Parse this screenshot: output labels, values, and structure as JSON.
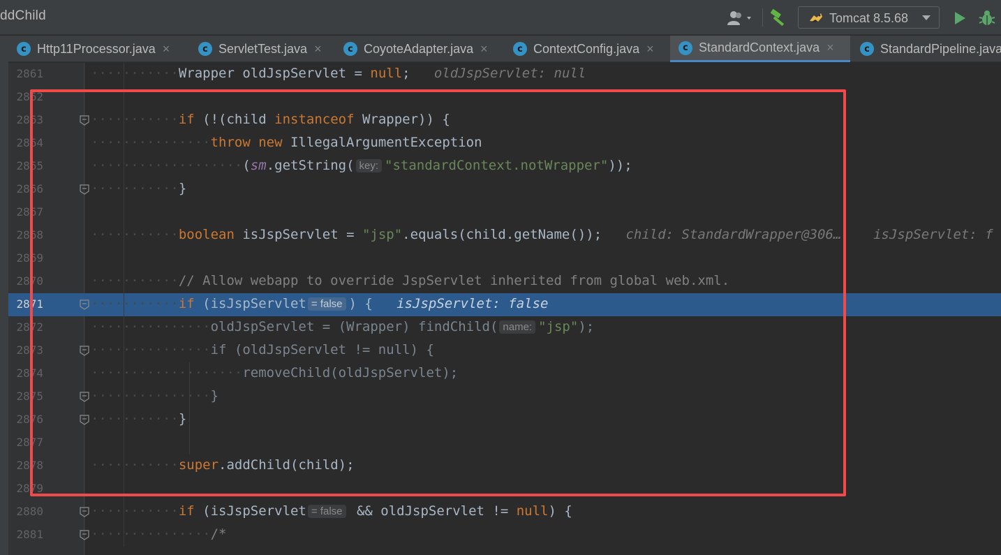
{
  "toolbar": {
    "title": "ddChild",
    "run_config_label": "Tomcat 8.5.68"
  },
  "colors": {
    "accent": "#4a88c7",
    "selection": "#2d5a8c",
    "annotation": "#f04a4a",
    "keyword": "#cc7832",
    "string": "#6a8759"
  },
  "tabs": [
    {
      "label": "Http11Processor.java",
      "icon": "class-c-icon",
      "active": false
    },
    {
      "label": "ServletTest.java",
      "icon": "class-c-icon",
      "active": false
    },
    {
      "label": "CoyoteAdapter.java",
      "icon": "class-c-icon",
      "active": false
    },
    {
      "label": "ContextConfig.java",
      "icon": "class-c-icon",
      "active": false
    },
    {
      "label": "StandardContext.java",
      "icon": "class-c-icon",
      "active": true
    },
    {
      "label": "StandardPipeline.java",
      "icon": "class-c-icon",
      "active": false
    }
  ],
  "editor": {
    "current_line": "2871",
    "lines": [
      {
        "n": "2861",
        "dots": "···········",
        "code": [
          [
            "p",
            "Wrapper oldJspServlet = "
          ],
          [
            "kw",
            "null"
          ],
          [
            "p",
            ";"
          ],
          [
            "iv",
            "   oldJspServlet: null"
          ]
        ]
      },
      {
        "n": "2862",
        "dots": "",
        "code": []
      },
      {
        "n": "2863",
        "dots": "···········",
        "fold": true,
        "code": [
          [
            "kw",
            "if"
          ],
          [
            "p",
            " (!(child "
          ],
          [
            "kw",
            "instanceof"
          ],
          [
            "p",
            " Wrapper)) {"
          ]
        ]
      },
      {
        "n": "2864",
        "dots": "···············",
        "code": [
          [
            "kw",
            "throw new"
          ],
          [
            "p",
            " IllegalArgumentException"
          ]
        ]
      },
      {
        "n": "2865",
        "dots": "···················",
        "code": [
          [
            "p",
            "("
          ],
          [
            "it",
            "sm"
          ],
          [
            "p",
            ".getString("
          ],
          [
            "h",
            "key:"
          ],
          [
            "s",
            "\"standardContext.notWrapper\""
          ],
          [
            "p",
            "));"
          ]
        ]
      },
      {
        "n": "2866",
        "dots": "···········",
        "fold": true,
        "code": [
          [
            "p",
            "}"
          ]
        ]
      },
      {
        "n": "2867",
        "dots": "",
        "code": []
      },
      {
        "n": "2868",
        "dots": "···········",
        "code": [
          [
            "kw",
            "boolean"
          ],
          [
            "p",
            " isJspServlet = "
          ],
          [
            "s",
            "\"jsp\""
          ],
          [
            "p",
            ".equals(child.getName());"
          ],
          [
            "iv",
            "   child: StandardWrapper@306…    isJspServlet: f"
          ]
        ]
      },
      {
        "n": "2869",
        "dots": "",
        "code": []
      },
      {
        "n": "2870",
        "dots": "···········",
        "code": [
          [
            "c",
            "// Allow webapp to override JspServlet inherited from global web.xml."
          ]
        ]
      },
      {
        "n": "2871",
        "dots": "···········",
        "fold": true,
        "current": true,
        "code": [
          [
            "kw",
            "if"
          ],
          [
            "p",
            " (isJspServlet"
          ],
          [
            "h",
            "= false"
          ],
          [
            "p",
            ") {"
          ],
          [
            "iv",
            "   isJspServlet: false"
          ]
        ]
      },
      {
        "n": "2872",
        "dots": "···············",
        "code": [
          [
            "d",
            "oldJspServlet = (Wrapper) findChild("
          ],
          [
            "h",
            "name:"
          ],
          [
            "s",
            "\"jsp\""
          ],
          [
            "d",
            ");"
          ]
        ]
      },
      {
        "n": "2873",
        "dots": "···············",
        "fold": true,
        "code": [
          [
            "d",
            "if (oldJspServlet != null) {"
          ]
        ]
      },
      {
        "n": "2874",
        "dots": "···················",
        "code": [
          [
            "d",
            "removeChild(oldJspServlet);"
          ]
        ]
      },
      {
        "n": "2875",
        "dots": "···············",
        "fold": true,
        "code": [
          [
            "d",
            "}"
          ]
        ]
      },
      {
        "n": "2876",
        "dots": "···········",
        "fold": true,
        "code": [
          [
            "p",
            "}"
          ]
        ]
      },
      {
        "n": "2877",
        "dots": "",
        "code": []
      },
      {
        "n": "2878",
        "dots": "···········",
        "code": [
          [
            "kw",
            "super"
          ],
          [
            "p",
            ".addChild(child);"
          ]
        ]
      },
      {
        "n": "2879",
        "dots": "",
        "code": []
      },
      {
        "n": "2880",
        "dots": "···········",
        "fold": true,
        "code": [
          [
            "kw",
            "if"
          ],
          [
            "p",
            " (isJspServlet"
          ],
          [
            "h",
            "= false"
          ],
          [
            "p",
            " && oldJspServlet != "
          ],
          [
            "kw",
            "null"
          ],
          [
            "p",
            ") {"
          ]
        ]
      },
      {
        "n": "2881",
        "dots": "···············",
        "fold": true,
        "code": [
          [
            "c",
            "/*"
          ]
        ]
      }
    ]
  }
}
